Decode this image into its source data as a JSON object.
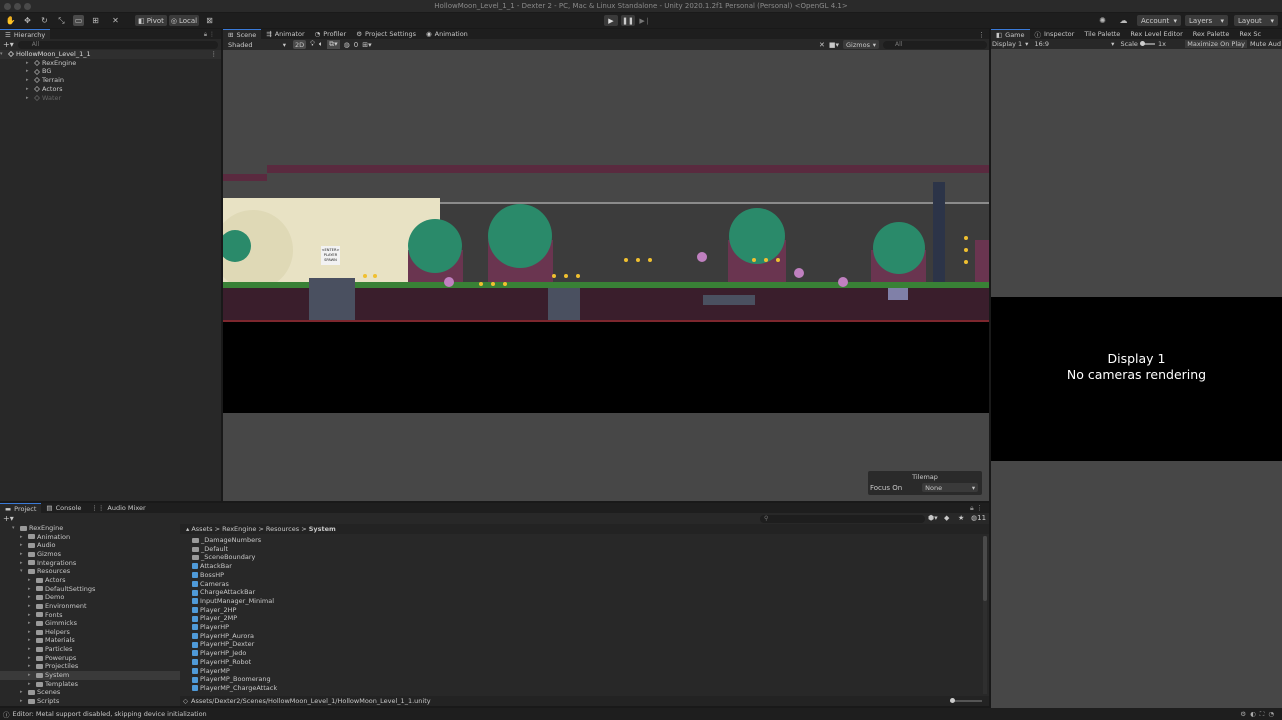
{
  "window": {
    "title": "HollowMoon_Level_1_1 - Dexter 2 - PC, Mac & Linux Standalone - Unity 2020.1.2f1 Personal (Personal) <OpenGL 4.1>"
  },
  "toolbar": {
    "pivot": "Pivot",
    "local": "Local",
    "account": "Account",
    "layers": "Layers",
    "layout": "Layout"
  },
  "hierarchy": {
    "tab": "Hierarchy",
    "search_placeholder": "All",
    "scene": "HollowMoon_Level_1_1",
    "items": [
      "RexEngine",
      "BG",
      "Terrain",
      "Actors",
      "Water"
    ]
  },
  "scene_tabs": [
    "Scene",
    "Animator",
    "Profiler",
    "Project Settings",
    "Animation"
  ],
  "scene_toolbar": {
    "shading": "Shaded",
    "mode2d": "2D",
    "fx_count": "0",
    "gizmos": "Gizmos",
    "search_placeholder": "All"
  },
  "scene_view": {
    "sign_line1": "<ENTER>",
    "sign_line2": "PLAYER",
    "sign_line3": "SPAWN"
  },
  "tilemap": {
    "title": "Tilemap",
    "focus_label": "Focus On",
    "focus_value": "None"
  },
  "right_tabs": [
    "Game",
    "Inspector",
    "Tile Palette",
    "Rex Level Editor",
    "Rex Palette",
    "Rex Sc"
  ],
  "game": {
    "display": "Display 1",
    "aspect": "16:9",
    "scale_label": "Scale",
    "scale_value": "1x",
    "maximize": "Maximize On Play",
    "mute": "Mute Aud",
    "msg_line1": "Display 1",
    "msg_line2": "No cameras rendering"
  },
  "bottom_tabs": [
    "Project",
    "Console",
    "Audio Mixer"
  ],
  "project_tree": [
    {
      "label": "RexEngine",
      "level": 0,
      "open": true
    },
    {
      "label": "Animation",
      "level": 1
    },
    {
      "label": "Audio",
      "level": 1
    },
    {
      "label": "Gizmos",
      "level": 1
    },
    {
      "label": "Integrations",
      "level": 1
    },
    {
      "label": "Resources",
      "level": 1,
      "open": true
    },
    {
      "label": "Actors",
      "level": 2
    },
    {
      "label": "DefaultSettings",
      "level": 2
    },
    {
      "label": "Demo",
      "level": 2
    },
    {
      "label": "Environment",
      "level": 2
    },
    {
      "label": "Fonts",
      "level": 2
    },
    {
      "label": "Gimmicks",
      "level": 2
    },
    {
      "label": "Helpers",
      "level": 2
    },
    {
      "label": "Materials",
      "level": 2
    },
    {
      "label": "Particles",
      "level": 2
    },
    {
      "label": "Powerups",
      "level": 2
    },
    {
      "label": "Projectiles",
      "level": 2
    },
    {
      "label": "System",
      "level": 2,
      "selected": true
    },
    {
      "label": "Templates",
      "level": 2
    },
    {
      "label": "Scenes",
      "level": 1
    },
    {
      "label": "Scripts",
      "level": 1
    }
  ],
  "breadcrumb": [
    "Assets",
    "RexEngine",
    "Resources",
    "System"
  ],
  "project_files": [
    {
      "name": "_DamageNumbers",
      "kind": "folder"
    },
    {
      "name": "_Default",
      "kind": "folder"
    },
    {
      "name": "_SceneBoundary",
      "kind": "folder"
    },
    {
      "name": "AttackBar",
      "kind": "prefab"
    },
    {
      "name": "BossHP",
      "kind": "prefab"
    },
    {
      "name": "Cameras",
      "kind": "prefab"
    },
    {
      "name": "ChargeAttackBar",
      "kind": "prefab"
    },
    {
      "name": "InputManager_Minimal",
      "kind": "prefab"
    },
    {
      "name": "Player_2HP",
      "kind": "prefab"
    },
    {
      "name": "Player_2MP",
      "kind": "prefab"
    },
    {
      "name": "PlayerHP",
      "kind": "prefab"
    },
    {
      "name": "PlayerHP_Aurora",
      "kind": "prefab"
    },
    {
      "name": "PlayerHP_Dexter",
      "kind": "prefab"
    },
    {
      "name": "PlayerHP_Jedo",
      "kind": "prefab"
    },
    {
      "name": "PlayerHP_Robot",
      "kind": "prefab"
    },
    {
      "name": "PlayerMP",
      "kind": "prefab"
    },
    {
      "name": "PlayerMP_Boomerang",
      "kind": "prefab"
    },
    {
      "name": "PlayerMP_ChargeAttack",
      "kind": "prefab"
    }
  ],
  "project_status": {
    "path": "Assets/Dexter2/Scenes/HollowMoon_Level_1/HollowMoon_Level_1_1.unity",
    "count": "11"
  },
  "statusbar": {
    "message": "Editor: Metal support disabled, skipping device initialization"
  }
}
